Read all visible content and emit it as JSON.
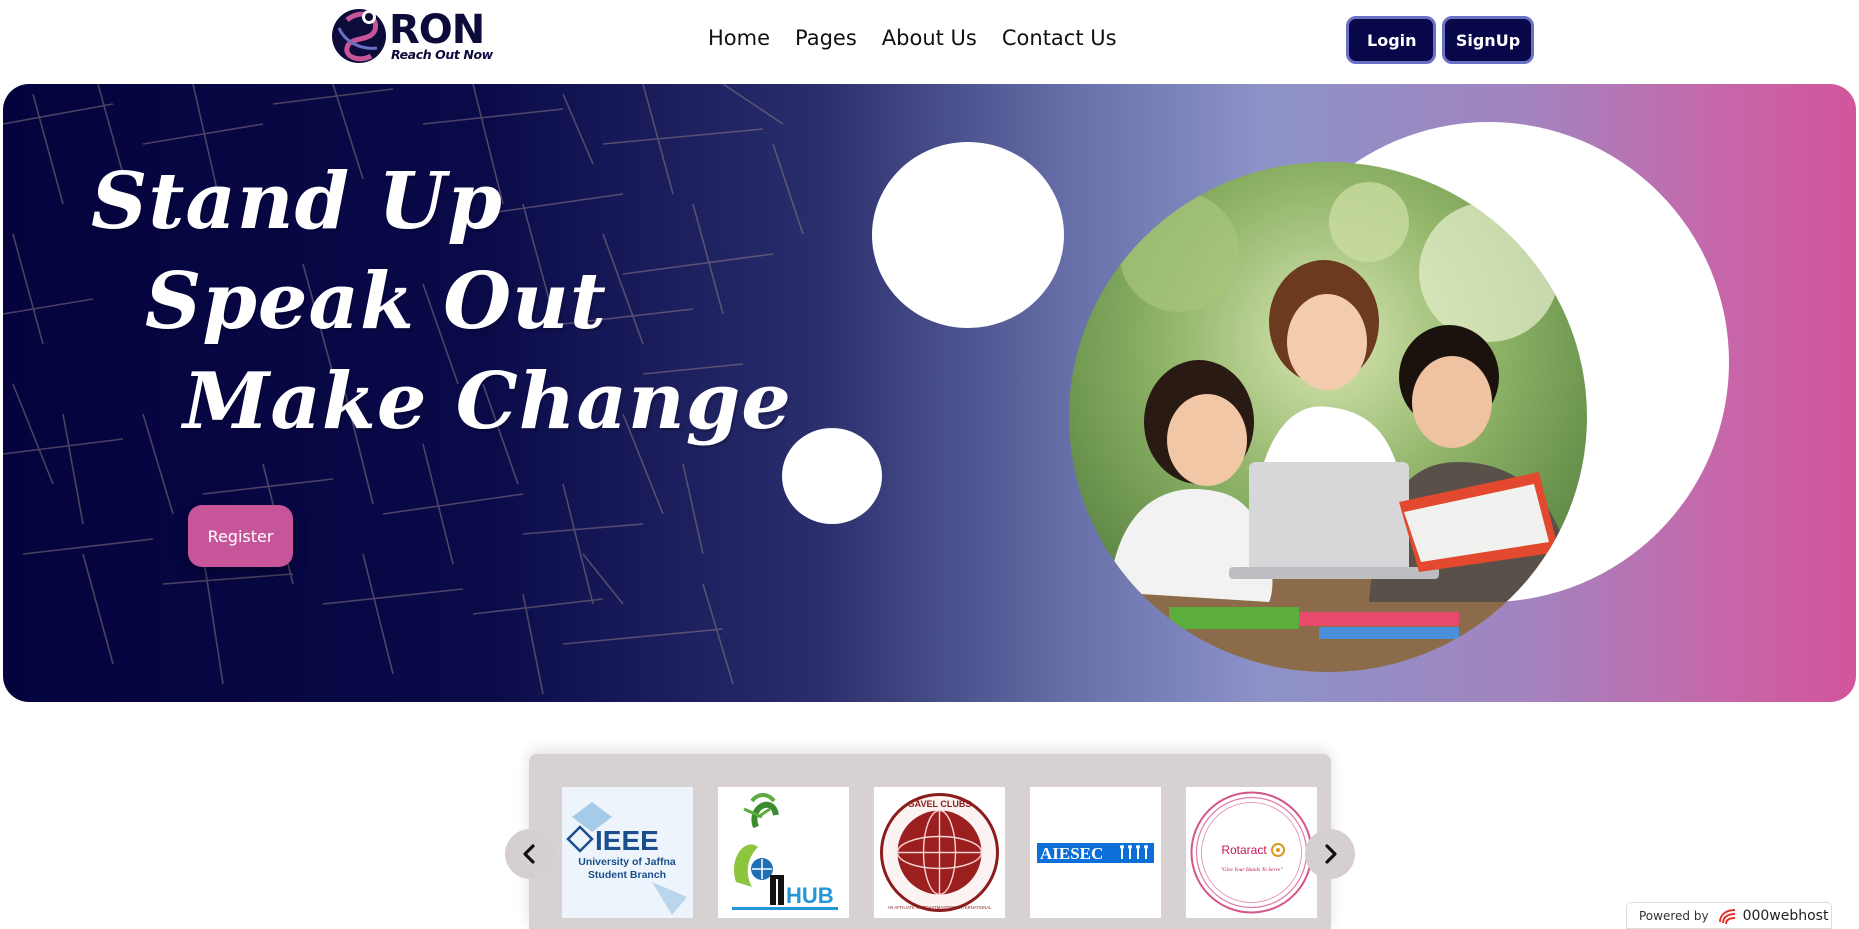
{
  "brand": {
    "name": "RON",
    "tagline": "Reach Out Now"
  },
  "nav": {
    "items": [
      "Home",
      "Pages",
      "About Us",
      "Contact Us"
    ]
  },
  "auth": {
    "login": "Login",
    "signup": "SignUp"
  },
  "hero": {
    "line1": "Stand Up",
    "line2": "Speak Out",
    "line3": "Make Change",
    "register_label": "Register"
  },
  "partners": {
    "ieee": {
      "name": "IEEE",
      "line1": "University of Jaffna",
      "line2": "Student Branch"
    },
    "iihub": {
      "name": "HUB"
    },
    "gavel": {
      "top": "GAVEL CLUBS",
      "bottom": "AN AFFILIATE OF TOASTMASTERS INTERNATIONAL"
    },
    "aiesec": {
      "name": "AIESEC"
    },
    "rotaract": {
      "name": "Rotaract",
      "motto": "\"Give Your Hands To Serve\""
    }
  },
  "footer": {
    "powered_label": "Powered by",
    "powered_brand": "000webhost"
  },
  "colors": {
    "navy": "#08074a",
    "pink": "#c6559a",
    "carousel_bg": "#d8d1d1"
  }
}
